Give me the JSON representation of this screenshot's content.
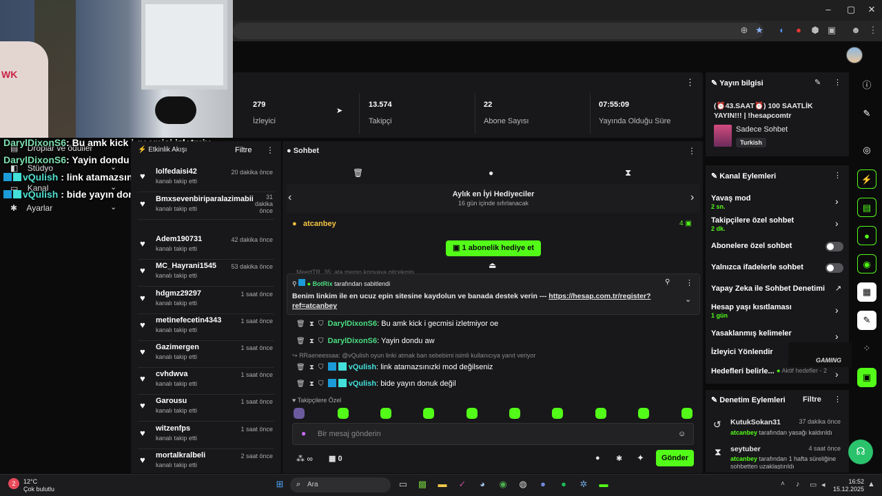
{
  "browser": {
    "window_controls": [
      "–",
      "▢",
      "✕"
    ],
    "extensions": [
      "zoom-icon",
      "star-icon",
      "translate-icon",
      "record-icon",
      "shield-icon",
      "puzzle-icon",
      "profile-icon",
      "menu-icon"
    ]
  },
  "overlay_chat": [
    {
      "user": "DarylDixonS6",
      "text": ": Bu amk kick i gecmisi izletmiy",
      "badge": false
    },
    {
      "user": "DarylDixonS6",
      "text": ": Yayin dondu aw",
      "badge": false
    },
    {
      "user": "vQulish",
      "text": " : link atamazsınızki mod değilse",
      "badge": true
    },
    {
      "user": "vQulish",
      "text": " : bide yayın donuk değil",
      "badge": true
    }
  ],
  "webcam": {
    "chair_text": "WK"
  },
  "left_nav": [
    {
      "label": "Droplar ve ödüller",
      "icon": "gift-icon"
    },
    {
      "label": "Stüdyo",
      "icon": "camera-icon"
    },
    {
      "label": "Kanal",
      "icon": "tv-icon"
    },
    {
      "label": "Ayarlar",
      "icon": "gear-icon"
    }
  ],
  "stats": [
    {
      "value": "279",
      "label": "İzleyici"
    },
    {
      "value": "13.574",
      "label": "Takipçi"
    },
    {
      "value": "22",
      "label": "Abone Sayısı"
    },
    {
      "value": "07:55:09",
      "label": "Yayında Olduğu Süre"
    }
  ],
  "activity": {
    "title": "Etkinlik Akışı",
    "filter": "Filtre",
    "rows": [
      {
        "name": "lolfedaisi42",
        "time": "20 dakika önce",
        "sub": "kanalı takip etti"
      },
      {
        "name": "Bmxsevenbiriparalazimabii",
        "time": "31 dakika önce",
        "sub": "kanalı takip etti"
      },
      {
        "name": "Adem190731",
        "time": "42 dakika önce",
        "sub": "kanalı takip etti"
      },
      {
        "name": "MC_Hayrani1545",
        "time": "53 dakika önce",
        "sub": "kanalı takip etti"
      },
      {
        "name": "hdgmz29297",
        "time": "1 saat önce",
        "sub": "kanalı takip etti"
      },
      {
        "name": "metinefecetin4343",
        "time": "1 saat önce",
        "sub": "kanalı takip etti"
      },
      {
        "name": "Gazimergen",
        "time": "1 saat önce",
        "sub": "kanalı takip etti"
      },
      {
        "name": "cvhdwva",
        "time": "1 saat önce",
        "sub": "kanalı takip etti"
      },
      {
        "name": "Garousu",
        "time": "1 saat önce",
        "sub": "kanalı takip etti"
      },
      {
        "name": "witzenfps",
        "time": "1 saat önce",
        "sub": "kanalı takip etti"
      },
      {
        "name": "mortalkralbeli",
        "time": "2 saat önce",
        "sub": "kanalı takip etti"
      }
    ]
  },
  "chat": {
    "title": "Sohbet",
    "gifters_title": "Aylık en İyi Hediyeciler",
    "gifters_sub": "16 gün içinde sıfırlanacak",
    "top_gifter": "atcanbey",
    "top_gifter_count": "4",
    "gift_button": "1 abonelik hediye et",
    "faded_line": "MeertTR_35: ata memo konyaya gitcekmiş",
    "pinned_by": "BotRix",
    "pinned_label": "tarafından sabitlendi",
    "pinned_text": "Benim linkim ile en ucuz epin sitesine kaydolun ve banada destek verin --- ",
    "pinned_link": "https://hesap.com.tr/register?ref=atcanbey",
    "messages": [
      {
        "user": "DarylDixonS6",
        "text": ": Bu amk kick i gecmisi izletmiyor oe",
        "color": "green",
        "reply": ""
      },
      {
        "user": "DarylDixonS6",
        "text": ": Yayin dondu aw",
        "color": "green",
        "reply": ""
      },
      {
        "user": "vQulish",
        "text": ": link atamazsınızki mod değilseniz",
        "color": "cyan",
        "reply": "RRaeneessaa: @vQulish oyun linki atmak ban sebebimi isimli kullanıcıya yanıt veriyor"
      },
      {
        "user": "vQulish",
        "text": ": bide yayın donuk değil",
        "color": "cyan",
        "reply": ""
      }
    ],
    "followers_only": "Takipçilere Özel",
    "placeholder": "Bir mesaj gönderin",
    "points": "∞",
    "count": "0",
    "send": "Gönder"
  },
  "stream_info": {
    "title": "Yayın bilgisi",
    "stream_title": "(⏰43.SAAT⏰) 100 SAATLİK YAYIN!!! | !hesapcomtr",
    "category": "Sadece Sohbet",
    "language": "Turkish"
  },
  "channel_actions": {
    "title": "Kanal Eylemleri",
    "items": [
      {
        "label": "Yavaş mod",
        "sub": "2 sn.",
        "control": "chevron"
      },
      {
        "label": "Takipçilere özel sohbet",
        "sub": "2 dk.",
        "control": "chevron"
      },
      {
        "label": "Abonelere özel sohbet",
        "sub": "",
        "control": "toggle"
      },
      {
        "label": "Yalnızca ifadelerle sohbet",
        "sub": "",
        "control": "toggle"
      },
      {
        "label": "Yapay Zeka ile Sohbet Denetimi",
        "sub": "",
        "control": "external"
      },
      {
        "label": "Hesap yaşı kısıtlaması",
        "sub": "1 gün",
        "control": "chevron"
      },
      {
        "label": "Yasaklanmış kelimeler",
        "sub": "",
        "control": "chevron"
      },
      {
        "label": "İzleyici Yönlendir",
        "sub": "",
        "control": "none"
      },
      {
        "label": "Hedefleri belirle...",
        "sub": "",
        "control": "chevron"
      }
    ],
    "goals_status": "Aktif hedefler - 2",
    "watermark": "GAMING"
  },
  "moderation": {
    "title": "Denetim Eylemleri",
    "filter": "Filtre",
    "rows": [
      {
        "user": "KutukSokan31",
        "time": "37 dakika önce",
        "actor": "atcanbey",
        "action": " tarafından yasağı kaldırıldı"
      },
      {
        "user": "seytuber",
        "time": "4 saat önce",
        "actor": "atcanbey",
        "action": " tarafından 1 hafta süreliğine sohbetten uzaklaştırıldı"
      }
    ]
  },
  "taskbar": {
    "temp": "12°C",
    "weather": "Çok bulutlu",
    "weather_badge": "2",
    "search": "Ara",
    "time": "16:52",
    "date": "15.12.2025"
  },
  "colors": {
    "accent": "#53fc18",
    "panel": "#18181b",
    "bg": "#0b0b0c"
  }
}
